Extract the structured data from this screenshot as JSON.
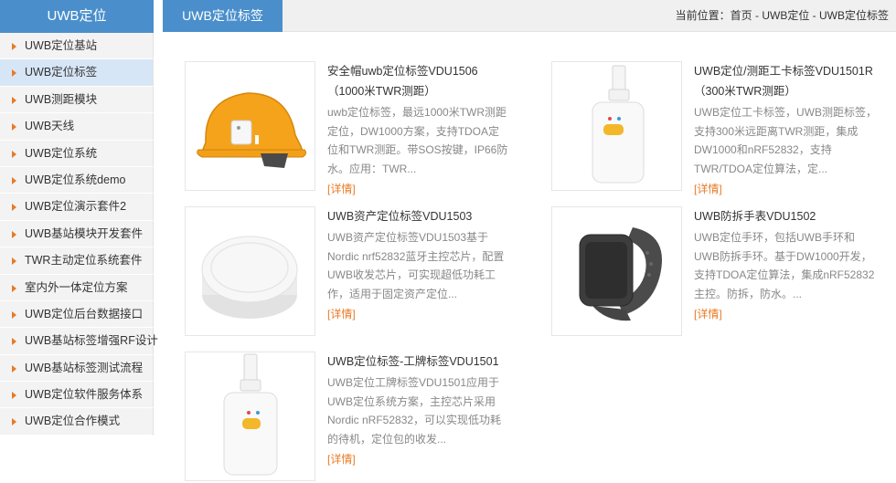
{
  "sidebar": {
    "title": "UWB定位",
    "items": [
      {
        "label": "UWB定位基站",
        "active": false
      },
      {
        "label": "UWB定位标签",
        "active": true
      },
      {
        "label": "UWB测距模块",
        "active": false
      },
      {
        "label": "UWB天线",
        "active": false
      },
      {
        "label": "UWB定位系统",
        "active": false
      },
      {
        "label": "UWB定位系统demo",
        "active": false
      },
      {
        "label": "UWB定位演示套件2",
        "active": false
      },
      {
        "label": "UWB基站模块开发套件",
        "active": false
      },
      {
        "label": "TWR主动定位系统套件",
        "active": false
      },
      {
        "label": "室内外一体定位方案",
        "active": false
      },
      {
        "label": "UWB定位后台数据接口",
        "active": false
      },
      {
        "label": "UWB基站标签增强RF设计",
        "active": false
      },
      {
        "label": "UWB基站标签测试流程",
        "active": false
      },
      {
        "label": "UWB定位软件服务体系",
        "active": false
      },
      {
        "label": "UWB定位合作模式",
        "active": false
      }
    ]
  },
  "header": {
    "tab": "UWB定位标签",
    "breadcrumb": "当前位置：首页 - UWB定位 - UWB定位标签"
  },
  "products": [
    {
      "title": "安全帽uwb定位标签VDU1506（1000米TWR测距）",
      "desc": "uwb定位标签，最远1000米TWR测距定位，DW1000方案，支持TDOA定位和TWR测距。带SOS按键，IP66防水。应用：TWR...",
      "more": "[详情]",
      "image": "helmet"
    },
    {
      "title": "UWB定位/测距工卡标签VDU1501R（300米TWR测距）",
      "desc": "UWB定位工卡标签，UWB测距标签，支持300米远距离TWR测距，集成DW1000和nRF52832，支持TWR/TDOA定位算法，定...",
      "more": "[详情]",
      "image": "badge"
    },
    {
      "title": "UWB资产定位标签VDU1503",
      "desc": "UWB资产定位标签VDU1503基于Nordic nrf52832蓝牙主控芯片，配置UWB收发芯片，可实现超低功耗工作，适用于固定资产定位...",
      "more": "[详情]",
      "image": "puck"
    },
    {
      "title": "UWB防拆手表VDU1502",
      "desc": "UWB定位手环，包括UWB手环和UWB防拆手环。基于DW1000开发，支持TDOA定位算法，集成nRF52832主控。防拆，防水。...",
      "more": "[详情]",
      "image": "watch"
    },
    {
      "title": "UWB定位标签-工牌标签VDU1501",
      "desc": "UWB定位工牌标签VDU1501应用于UWB定位系统方案，主控芯片采用Nordic nRF52832，可以实现低功耗的待机，定位包的收发...",
      "more": "[详情]",
      "image": "badge"
    }
  ],
  "colors": {
    "brand_blue": "#4a8fcb",
    "accent_orange": "#e87a25",
    "active_item_bg": "#d7e6f6"
  }
}
